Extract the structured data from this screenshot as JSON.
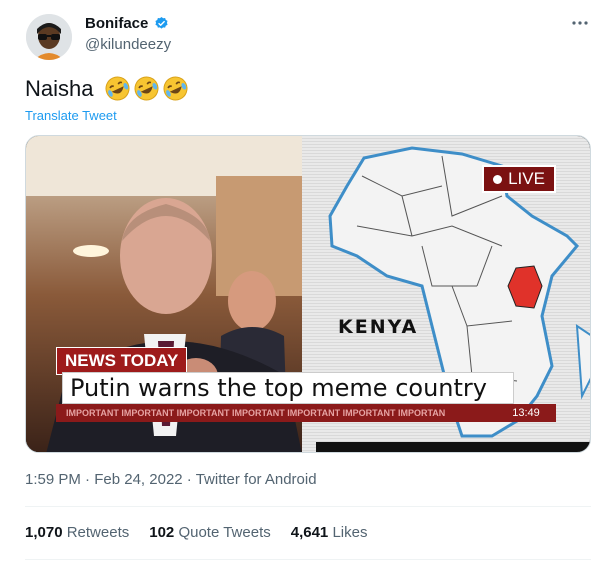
{
  "author": {
    "name": "Boniface",
    "handle": "@kilundeezy",
    "verified_icon": "verified-badge-icon",
    "avatar_icon": "avatar"
  },
  "more_icon": "more-horizontal-icon",
  "tweet": {
    "text": "Naisha",
    "emojis": [
      "rolling-on-floor-laughing",
      "rolling-on-floor-laughing",
      "rolling-on-floor-laughing"
    ],
    "translate_label": "Translate Tweet"
  },
  "media": {
    "live_label": "LIVE",
    "map_label": "KENYA",
    "news_tag": "NEWS TODAY",
    "headline": "Putin warns the top meme country",
    "ticker": "IMPORTANT IMPORTANT IMPORTANT IMPORTANT IMPORTANT IMPORTANT IMPORTAN",
    "time": "13:49"
  },
  "meta": {
    "time": "1:59 PM",
    "sep1": " · ",
    "date": "Feb 24, 2022",
    "sep2": " · ",
    "source": "Twitter for Android"
  },
  "stats": {
    "retweets_count": "1,070",
    "retweets_label": "Retweets",
    "quotes_count": "102",
    "quotes_label": "Quote Tweets",
    "likes_count": "4,641",
    "likes_label": "Likes"
  },
  "colors": {
    "accent": "#1d9bf0",
    "secondary_text": "#536471",
    "news_red": "#9e1b1b",
    "kenya_highlight": "#e0322a"
  }
}
